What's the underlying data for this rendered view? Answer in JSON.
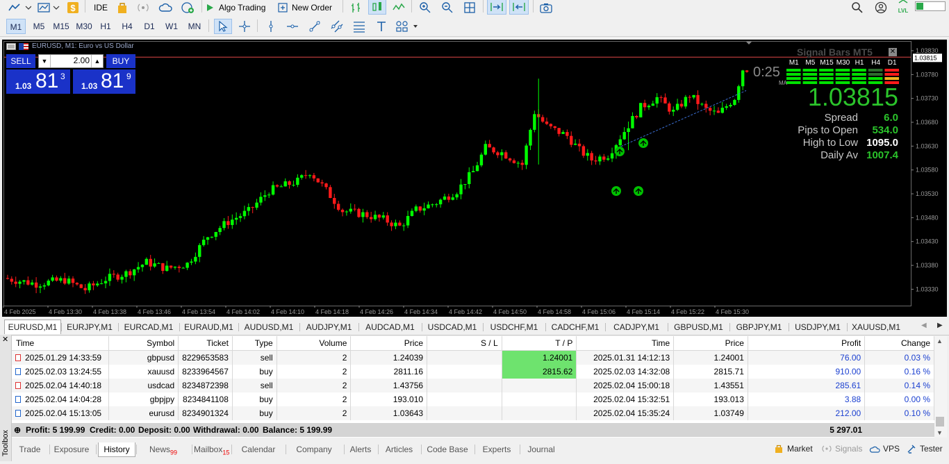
{
  "toolbar": {
    "ide_label": "IDE",
    "algo_trading_label": "Algo Trading",
    "new_order_label": "New Order"
  },
  "timeframes": [
    "M1",
    "M5",
    "M15",
    "M30",
    "H1",
    "H4",
    "D1",
    "W1",
    "MN"
  ],
  "chart": {
    "title": "EURUSD, M1: Euro vs US Dollar",
    "sell_label": "SELL",
    "buy_label": "BUY",
    "volume": "2.00",
    "sell_price_prefix": "1.03",
    "sell_price_big": "81",
    "sell_price_sup": "3",
    "buy_price_prefix": "1.03",
    "buy_price_big": "81",
    "buy_price_sup": "9",
    "countdown": "0:25",
    "current_price_tag": "1.03815",
    "y_ticks": [
      "1.03830",
      "1.03815",
      "1.03780",
      "1.03730",
      "1.03680",
      "1.03630",
      "1.03580",
      "1.03530",
      "1.03480",
      "1.03430",
      "1.03380",
      "1.03330"
    ],
    "x_ticks": [
      "4 Feb 2025",
      "4 Feb 13:30",
      "4 Feb 13:38",
      "4 Feb 13:46",
      "4 Feb 13:54",
      "4 Feb 14:02",
      "4 Feb 14:10",
      "4 Feb 14:18",
      "4 Feb 14:26",
      "4 Feb 14:34",
      "4 Feb 14:42",
      "4 Feb 14:50",
      "4 Feb 14:58",
      "4 Feb 15:06",
      "4 Feb 15:14",
      "4 Feb 15:22",
      "4 Feb 15:30"
    ],
    "colors": {
      "bull": "#00ff00",
      "bear": "#ff1a1a",
      "background": "#000000",
      "price_line": "#e04848"
    }
  },
  "indicator": {
    "title": "Signal Bars MT5",
    "timeframes": [
      "M1",
      "M5",
      "M15",
      "M30",
      "H1",
      "H4",
      "D1"
    ],
    "ma_label": "MA",
    "big_price": "1.03815",
    "rows": [
      {
        "label": "Spread",
        "value": "6.0"
      },
      {
        "label": "Pips to Open",
        "value": "534.0"
      },
      {
        "label": "High to Low",
        "value": "1095.0"
      },
      {
        "label": "Daily Av",
        "value": "1007.4"
      }
    ]
  },
  "symbol_tabs": [
    "EURUSD,M1",
    "EURJPY,M1",
    "EURCAD,M1",
    "EURAUD,M1",
    "AUDUSD,M1",
    "AUDJPY,M1",
    "AUDCAD,M1",
    "USDCAD,M1",
    "USDCHF,M1",
    "CADCHF,M1",
    "CADJPY,M1",
    "GBPUSD,M1",
    "GBPJPY,M1",
    "USDJPY,M1",
    "XAUUSD,M1"
  ],
  "history": {
    "headers": [
      "Time",
      "Symbol",
      "Ticket",
      "Type",
      "Volume",
      "Price",
      "S / L",
      "T / P",
      "Time",
      "Price",
      "Profit",
      "Change"
    ],
    "rows": [
      {
        "time": "2025.01.29 14:33:59",
        "symbol": "gbpusd",
        "ticket": "8229653583",
        "type": "sell",
        "volume": "2",
        "price": "1.24039",
        "sl": "",
        "tp": "1.24001",
        "close_time": "2025.01.31 14:12:13",
        "close_price": "1.24001",
        "profit": "76.00",
        "change": "0.03 %"
      },
      {
        "time": "2025.02.03 13:24:55",
        "symbol": "xauusd",
        "ticket": "8233964567",
        "type": "buy",
        "volume": "2",
        "price": "2811.16",
        "sl": "",
        "tp": "2815.62",
        "close_time": "2025.02.03 14:32:08",
        "close_price": "2815.71",
        "profit": "910.00",
        "change": "0.16 %"
      },
      {
        "time": "2025.02.04 14:40:18",
        "symbol": "usdcad",
        "ticket": "8234872398",
        "type": "sell",
        "volume": "2",
        "price": "1.43756",
        "sl": "",
        "tp": "",
        "close_time": "2025.02.04 15:00:18",
        "close_price": "1.43551",
        "profit": "285.61",
        "change": "0.14 %"
      },
      {
        "time": "2025.02.04 14:04:28",
        "symbol": "gbpjpy",
        "ticket": "8234841108",
        "type": "buy",
        "volume": "2",
        "price": "193.010",
        "sl": "",
        "tp": "",
        "close_time": "2025.02.04 15:32:51",
        "close_price": "193.013",
        "profit": "3.88",
        "change": "0.00 %"
      },
      {
        "time": "2025.02.04 15:13:05",
        "symbol": "eurusd",
        "ticket": "8234901324",
        "type": "buy",
        "volume": "2",
        "price": "1.03643",
        "sl": "",
        "tp": "",
        "close_time": "2025.02.04 15:35:24",
        "close_price": "1.03749",
        "profit": "212.00",
        "change": "0.10 %"
      }
    ],
    "summary": {
      "profit": "Profit: 5 199.99",
      "credit": "Credit: 0.00",
      "deposit": "Deposit: 0.00",
      "withdrawal": "Withdrawal: 0.00",
      "balance": "Balance: 5 199.99",
      "total": "5 297.01"
    }
  },
  "toolbox_label": "Toolbox",
  "bottom_tabs": [
    {
      "label": "Trade",
      "badge": ""
    },
    {
      "label": "Exposure",
      "badge": ""
    },
    {
      "label": "History",
      "badge": ""
    },
    {
      "label": "News",
      "badge": "99"
    },
    {
      "label": "Mailbox",
      "badge": "15"
    },
    {
      "label": "Calendar",
      "badge": ""
    },
    {
      "label": "Company",
      "badge": ""
    },
    {
      "label": "Alerts",
      "badge": ""
    },
    {
      "label": "Articles",
      "badge": ""
    },
    {
      "label": "Code Base",
      "badge": ""
    },
    {
      "label": "Experts",
      "badge": ""
    },
    {
      "label": "Journal",
      "badge": ""
    }
  ],
  "status_buttons": {
    "market": "Market",
    "signals": "Signals",
    "vps": "VPS",
    "tester": "Tester"
  }
}
